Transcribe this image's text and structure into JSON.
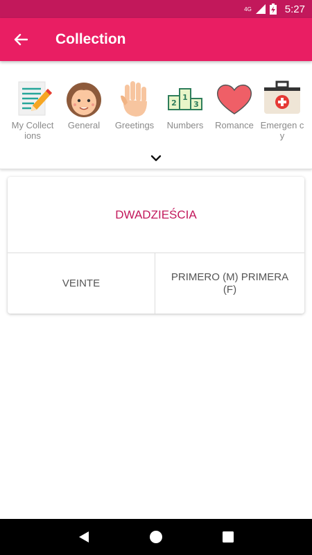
{
  "status_bar": {
    "network": "4G",
    "time": "5:27"
  },
  "app_bar": {
    "title": "Collection"
  },
  "categories": [
    {
      "label": "My Collect ions",
      "icon": "notepad-pencil-icon"
    },
    {
      "label": "General",
      "icon": "girl-face-icon"
    },
    {
      "label": "Greetings",
      "icon": "waving-hand-icon"
    },
    {
      "label": "Numbers",
      "icon": "podium-icon"
    },
    {
      "label": "Romance",
      "icon": "heart-icon"
    },
    {
      "label": "Emergen cy",
      "icon": "first-aid-kit-icon"
    }
  ],
  "card": {
    "word": "DWADZIEŚCIA",
    "options": [
      "VEINTE",
      "PRIMERO (M)  PRIMERA (F)"
    ]
  },
  "colors": {
    "status_bar": "#c2185b",
    "app_bar": "#e91e63",
    "accent_text": "#c2185b"
  }
}
